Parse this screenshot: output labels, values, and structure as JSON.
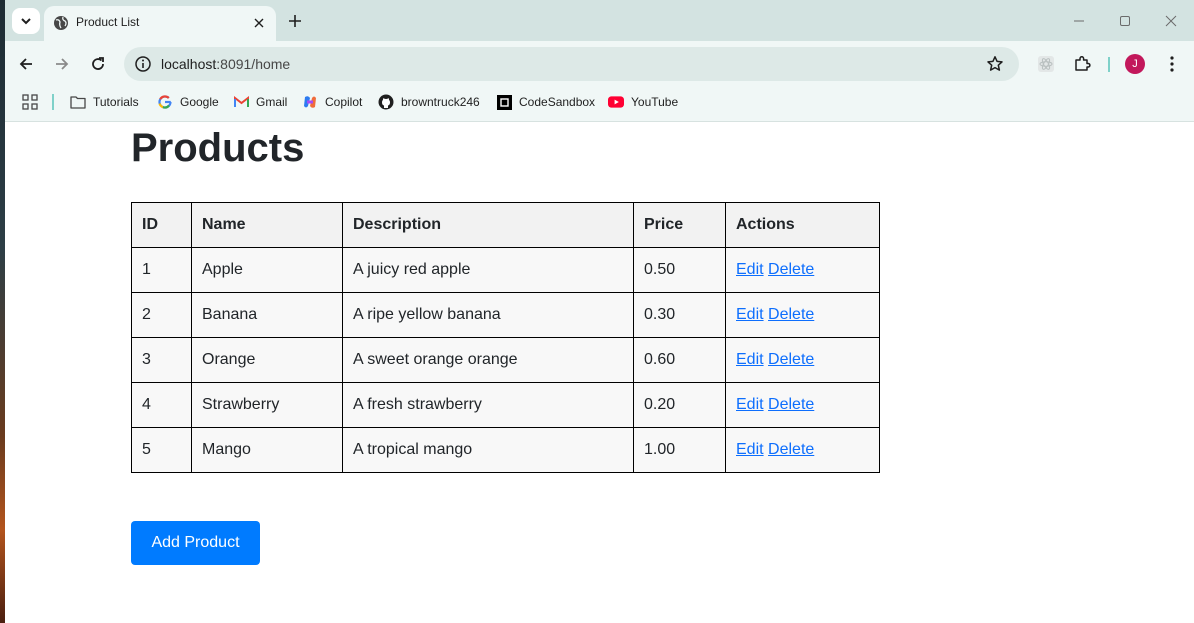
{
  "browser": {
    "tab_title": "Product List",
    "url_host": "localhost",
    "url_rest": ":8091/home",
    "avatar_initial": "J",
    "accent_color": "#7fd1c9"
  },
  "bookmarks": [
    {
      "label": "Tutorials",
      "icon": "folder-icon"
    },
    {
      "label": "Google",
      "icon": "google-icon"
    },
    {
      "label": "Gmail",
      "icon": "gmail-icon"
    },
    {
      "label": "Copilot",
      "icon": "copilot-icon"
    },
    {
      "label": "browntruck246",
      "icon": "github-icon"
    },
    {
      "label": "CodeSandbox",
      "icon": "codesandbox-icon"
    },
    {
      "label": "YouTube",
      "icon": "youtube-icon"
    }
  ],
  "page": {
    "title": "Products",
    "columns": [
      "ID",
      "Name",
      "Description",
      "Price",
      "Actions"
    ],
    "rows": [
      {
        "id": "1",
        "name": "Apple",
        "description": "A juicy red apple",
        "price": "0.50"
      },
      {
        "id": "2",
        "name": "Banana",
        "description": "A ripe yellow banana",
        "price": "0.30"
      },
      {
        "id": "3",
        "name": "Orange",
        "description": "A sweet orange orange",
        "price": "0.60"
      },
      {
        "id": "4",
        "name": "Strawberry",
        "description": "A fresh strawberry",
        "price": "0.20"
      },
      {
        "id": "5",
        "name": "Mango",
        "description": "A tropical mango",
        "price": "1.00"
      }
    ],
    "edit_label": "Edit",
    "delete_label": "Delete",
    "add_button_label": "Add Product",
    "button_color": "#007bff"
  }
}
